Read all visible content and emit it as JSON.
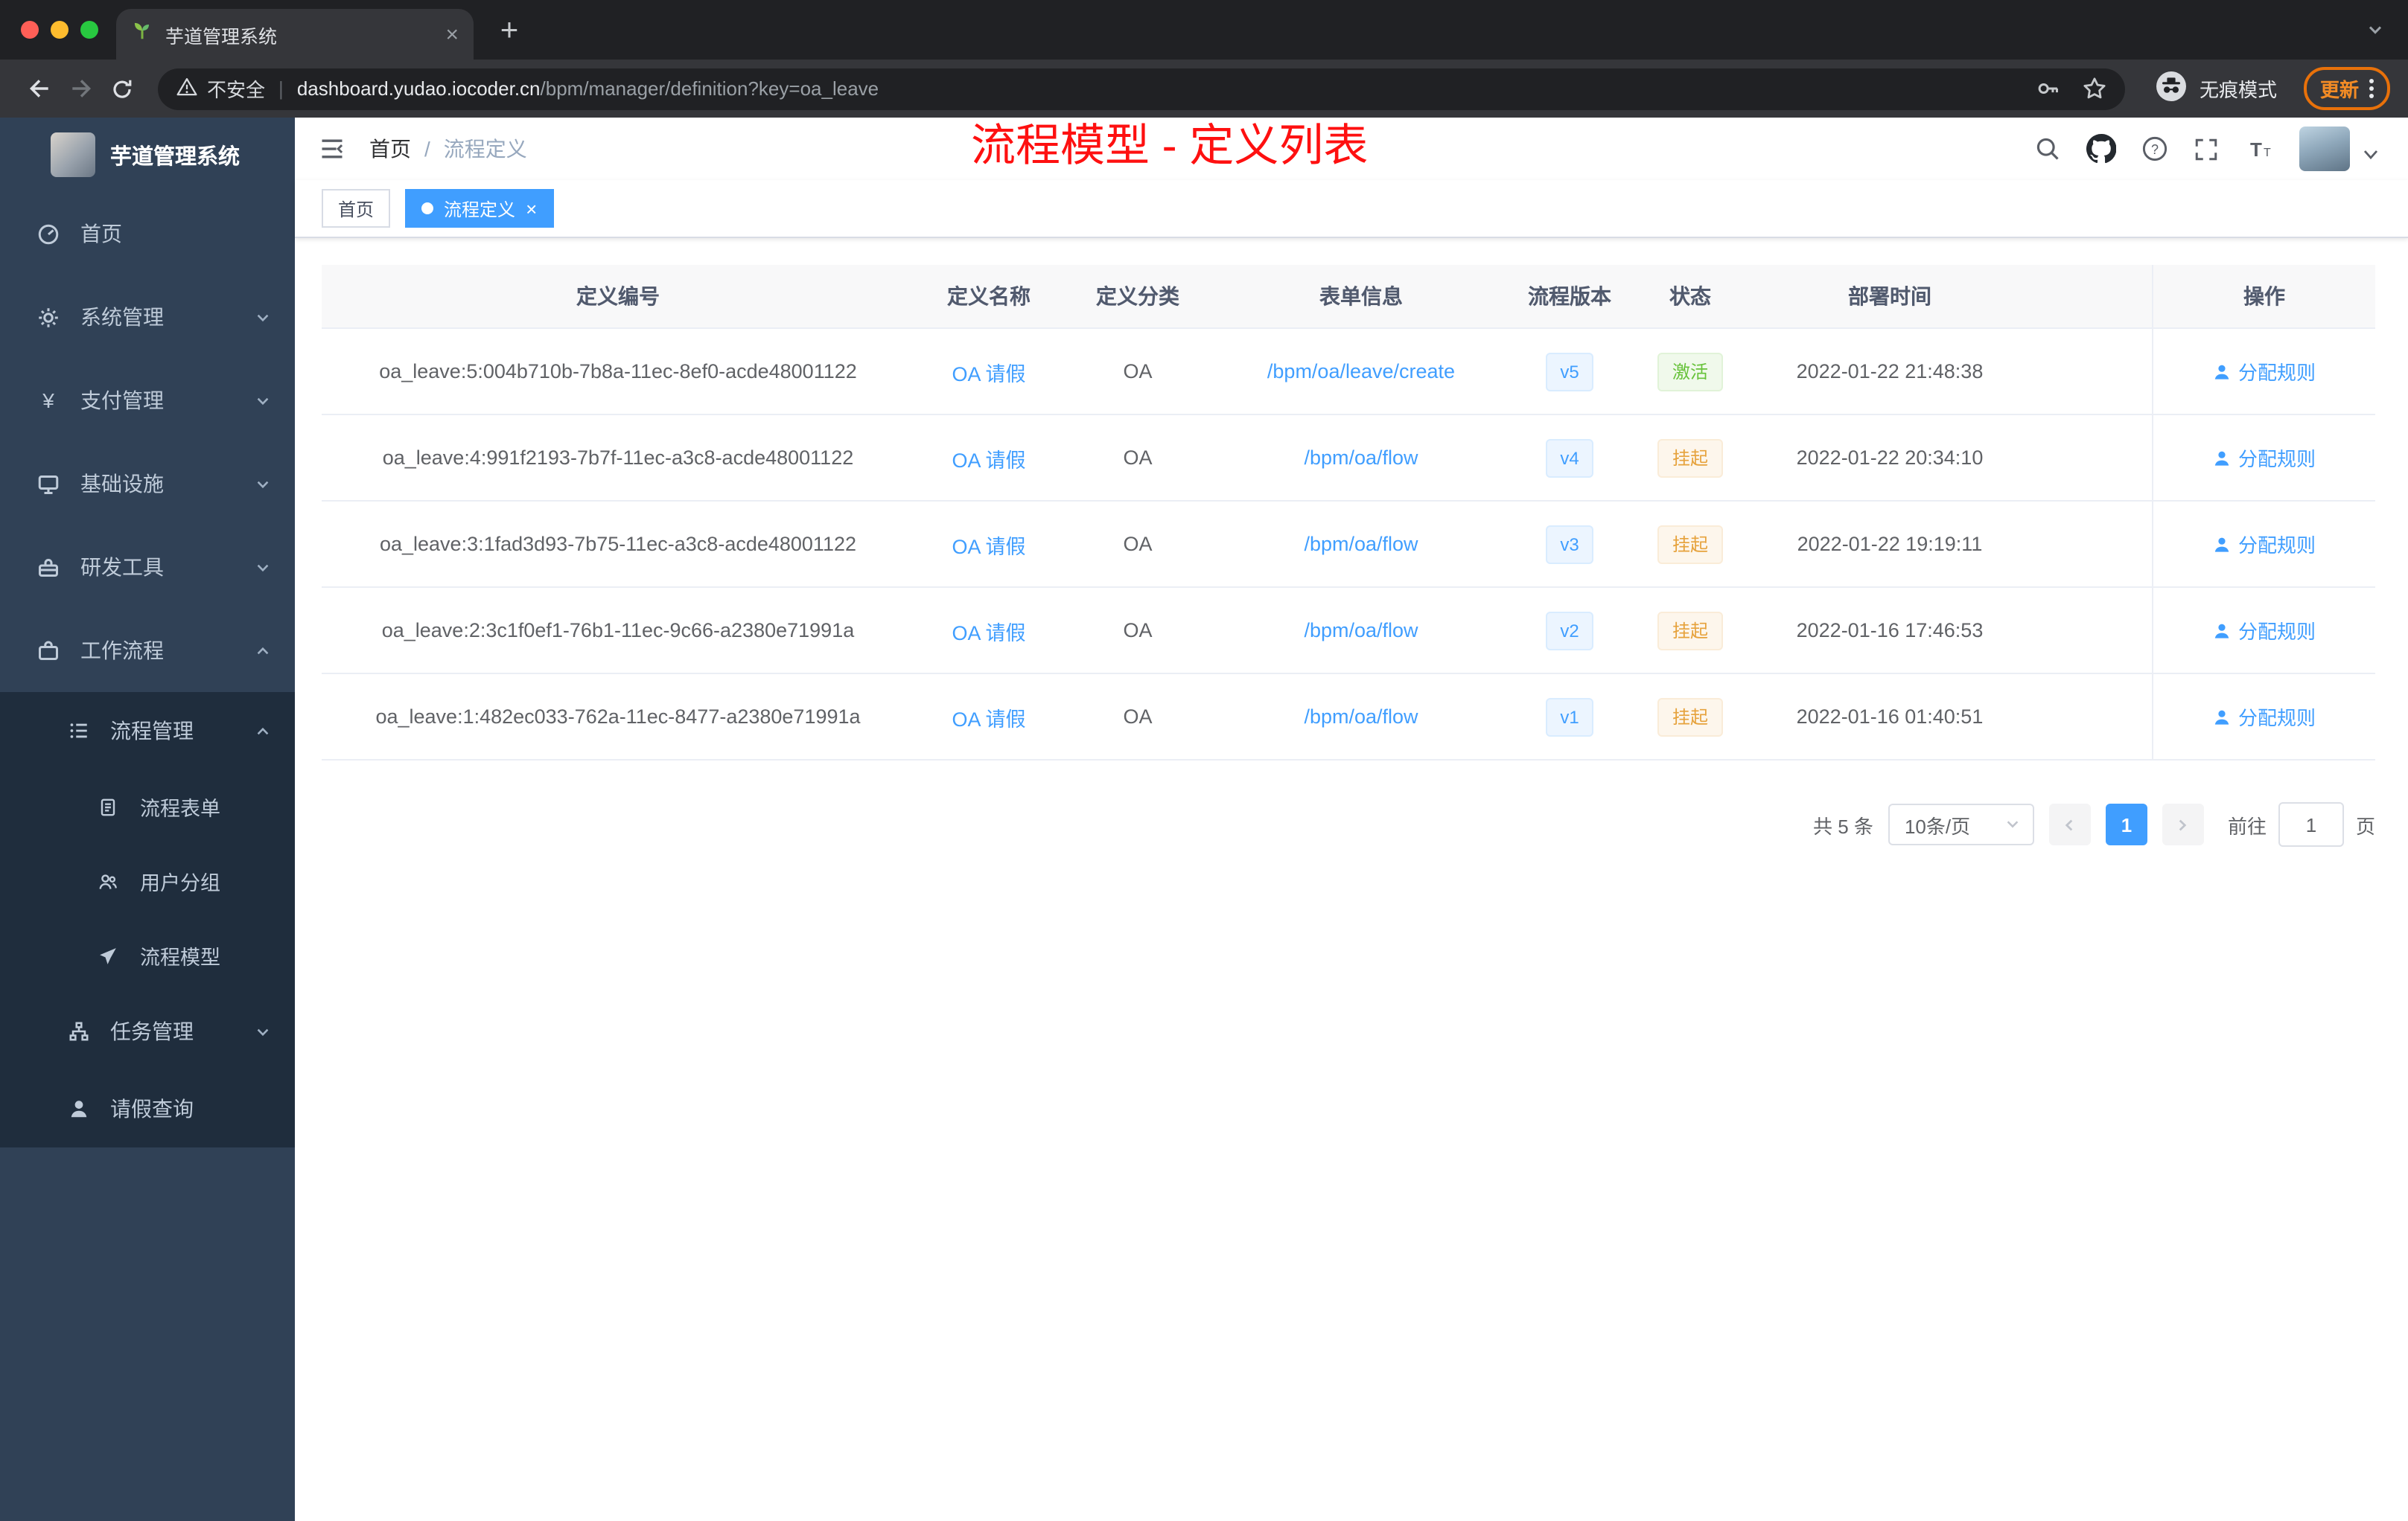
{
  "browser": {
    "tab_title": "芋道管理系统",
    "security_label": "不安全",
    "url_domain": "dashboard.yudao.iocoder.cn",
    "url_path": "/bpm/manager/definition?key=oa_leave",
    "incognito_label": "无痕模式",
    "update_label": "更新"
  },
  "sidebar": {
    "logo_title": "芋道管理系统",
    "items": [
      {
        "icon": "dashboard-icon",
        "label": "首页"
      },
      {
        "icon": "gear-icon",
        "label": "系统管理",
        "chevron": "down"
      },
      {
        "icon": "yen-icon",
        "label": "支付管理",
        "chevron": "down"
      },
      {
        "icon": "monitor-icon",
        "label": "基础设施",
        "chevron": "down"
      },
      {
        "icon": "toolbox-icon",
        "label": "研发工具",
        "chevron": "down"
      },
      {
        "icon": "briefcase-icon",
        "label": "工作流程",
        "chevron": "up"
      }
    ],
    "workflow_children": [
      {
        "icon": "list-icon",
        "label": "流程管理",
        "chevron": "up"
      },
      {
        "icon": "tree-icon",
        "label": "任务管理",
        "chevron": "down"
      },
      {
        "icon": "user-icon",
        "label": "请假查询"
      }
    ],
    "process_children": [
      {
        "icon": "form-icon",
        "label": "流程表单"
      },
      {
        "icon": "users-icon",
        "label": "用户分组"
      },
      {
        "icon": "send-icon",
        "label": "流程模型"
      }
    ]
  },
  "header": {
    "breadcrumb_home": "首页",
    "breadcrumb_sep": "/",
    "breadcrumb_current": "流程定义",
    "annotation": "流程模型 - 定义列表"
  },
  "tags": {
    "home": "首页",
    "current": "流程定义"
  },
  "table": {
    "columns": [
      "定义编号",
      "定义名称",
      "定义分类",
      "表单信息",
      "流程版本",
      "状态",
      "部署时间",
      "操作"
    ],
    "action_label": "分配规则",
    "rows": [
      {
        "id": "oa_leave:5:004b710b-7b8a-11ec-8ef0-acde48001122",
        "name": "OA 请假",
        "category": "OA",
        "form": "/bpm/oa/leave/create",
        "version": "v5",
        "status": "激活",
        "status_type": "success",
        "deploy_time": "2022-01-22 21:48:38"
      },
      {
        "id": "oa_leave:4:991f2193-7b7f-11ec-a3c8-acde48001122",
        "name": "OA 请假",
        "category": "OA",
        "form": "/bpm/oa/flow",
        "version": "v4",
        "status": "挂起",
        "status_type": "warning",
        "deploy_time": "2022-01-22 20:34:10"
      },
      {
        "id": "oa_leave:3:1fad3d93-7b75-11ec-a3c8-acde48001122",
        "name": "OA 请假",
        "category": "OA",
        "form": "/bpm/oa/flow",
        "version": "v3",
        "status": "挂起",
        "status_type": "warning",
        "deploy_time": "2022-01-22 19:19:11"
      },
      {
        "id": "oa_leave:2:3c1f0ef1-76b1-11ec-9c66-a2380e71991a",
        "name": "OA 请假",
        "category": "OA",
        "form": "/bpm/oa/flow",
        "version": "v2",
        "status": "挂起",
        "status_type": "warning",
        "deploy_time": "2022-01-16 17:46:53"
      },
      {
        "id": "oa_leave:1:482ec033-762a-11ec-8477-a2380e71991a",
        "name": "OA 请假",
        "category": "OA",
        "form": "/bpm/oa/flow",
        "version": "v1",
        "status": "挂起",
        "status_type": "warning",
        "deploy_time": "2022-01-16 01:40:51"
      }
    ]
  },
  "pagination": {
    "total": "共 5 条",
    "page_size": "10条/页",
    "current": "1",
    "goto_label": "前往",
    "goto_value": "1",
    "page_unit": "页"
  },
  "colors": {
    "accent": "#409eff",
    "success": "#67c23a",
    "warning": "#e6a23c",
    "annotation_red": "#fe1010",
    "update_orange": "#e8710a"
  }
}
